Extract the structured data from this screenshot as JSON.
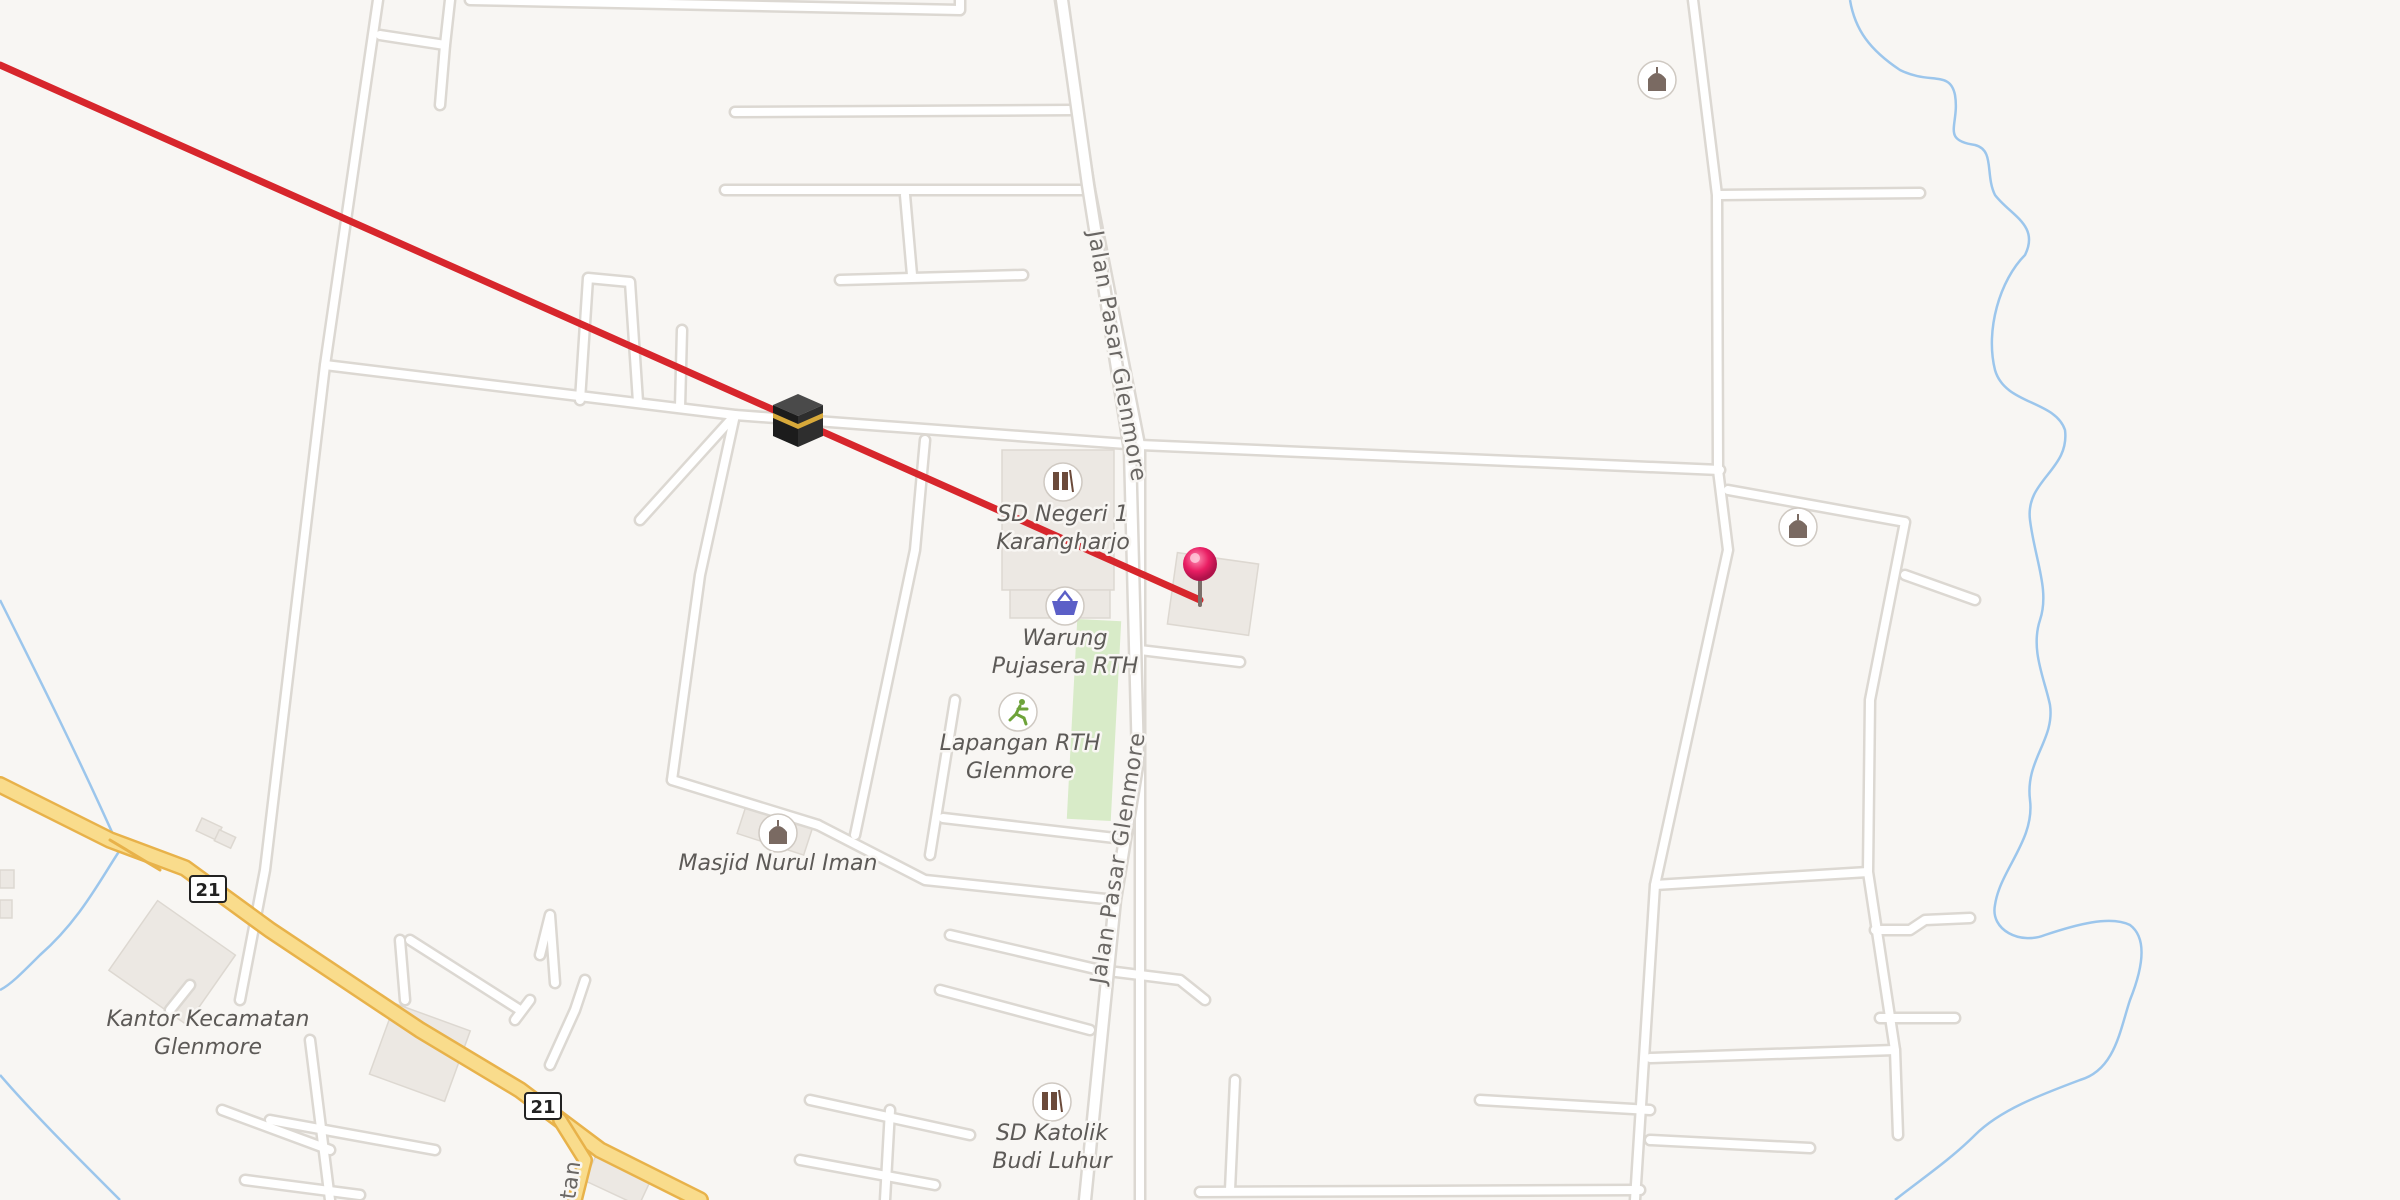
{
  "map": {
    "colors": {
      "background": "#f8f6f3",
      "road": "#ffffff",
      "road_casing": "#dcd8d2",
      "primary_road": "#f9dc8c",
      "primary_casing": "#e8b24a",
      "water": "#9cc6ec",
      "building": "#ece8e3",
      "park": "#d8ebc8",
      "route_line": "#d7262c",
      "pin": "#e91e63"
    },
    "street_labels": {
      "jalan_pasar_glenmore_north": "Jalan Pasar Glenmore",
      "jalan_pasar_glenmore_south": "Jalan Pasar Glenmore",
      "jalan_partial": "tan"
    },
    "road_shields": {
      "shield_a": "21",
      "shield_b": "21"
    },
    "pois": {
      "sd_negeri": {
        "icon": "school-icon",
        "line1": "SD Negeri 1",
        "line2": "Karangharjo"
      },
      "warung": {
        "icon": "shopping-basket-icon",
        "line1": "Warung",
        "line2": "Pujasera RTH"
      },
      "lapangan": {
        "icon": "sports-pitch-icon",
        "line1": "Lapangan RTH",
        "line2": "Glenmore"
      },
      "masjid_nurul_iman": {
        "icon": "mosque-icon",
        "line1": "Masjid Nurul Iman"
      },
      "kantor": {
        "line1": "Kantor Kecamatan",
        "line2": "Glenmore"
      },
      "sd_katolik": {
        "icon": "school-icon",
        "line1": "SD Katolik",
        "line2": "Budi Luhur"
      },
      "mosque_top_right": {
        "icon": "mosque-icon"
      },
      "mosque_right": {
        "icon": "mosque-icon"
      }
    },
    "markers": {
      "qibla_marker": {
        "icon": "kaaba-icon"
      },
      "location_pin": {
        "icon": "location-pin-icon"
      }
    },
    "route_line": {
      "name": "qibla-direction-line"
    }
  }
}
